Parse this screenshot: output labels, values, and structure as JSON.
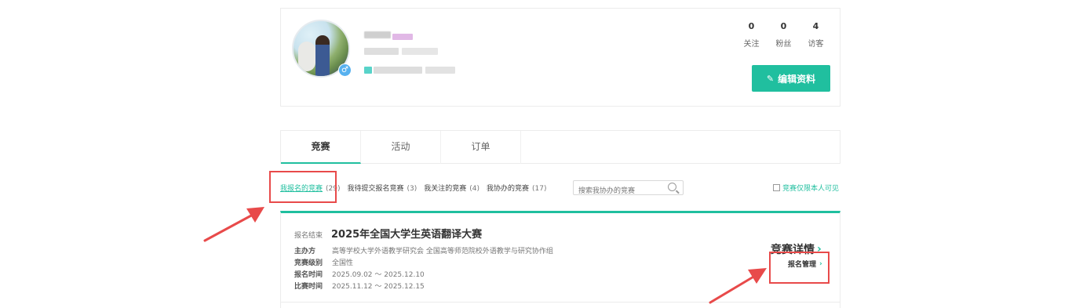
{
  "profile": {
    "gender_symbol": "♂",
    "stats": [
      {
        "num": "0",
        "label": "关注"
      },
      {
        "num": "0",
        "label": "粉丝"
      },
      {
        "num": "4",
        "label": "访客"
      }
    ],
    "edit_button": "编辑资料",
    "pencil_icon": "✎"
  },
  "tabs": [
    {
      "label": "竞赛",
      "active": true
    },
    {
      "label": "活动",
      "active": false
    },
    {
      "label": "订单",
      "active": false
    }
  ],
  "filters": [
    {
      "label": "我报名的竞赛",
      "count": "(29)",
      "active": true
    },
    {
      "label": "我待提交报名竞赛",
      "count": "(3)",
      "active": false
    },
    {
      "label": "我关注的竞赛",
      "count": "(4)",
      "active": false
    },
    {
      "label": "我协办的竞赛",
      "count": "(17)",
      "active": false
    }
  ],
  "search": {
    "placeholder": "搜索我协办的竞赛"
  },
  "private_label": "竞赛仅限本人可见",
  "competition": {
    "status": "报名结束",
    "title": "2025年全国大学生英语翻译大赛",
    "rows": [
      {
        "key": "主办方",
        "value": "高等学校大学外语教学研究会 全国高等师范院校外语教学与研究协作组"
      },
      {
        "key": "竞赛级别",
        "value": "全国性"
      },
      {
        "key": "报名时间",
        "value": "2025.09.02 ～ 2025.12.10"
      },
      {
        "key": "比赛时间",
        "value": "2025.11.12 ～ 2025.12.15"
      }
    ],
    "detail_link": "竞赛详情",
    "manage_link": "报名管理",
    "chevron": "›"
  },
  "colors": {
    "accent": "#20bf9f",
    "annotation": "#e84a4a"
  }
}
